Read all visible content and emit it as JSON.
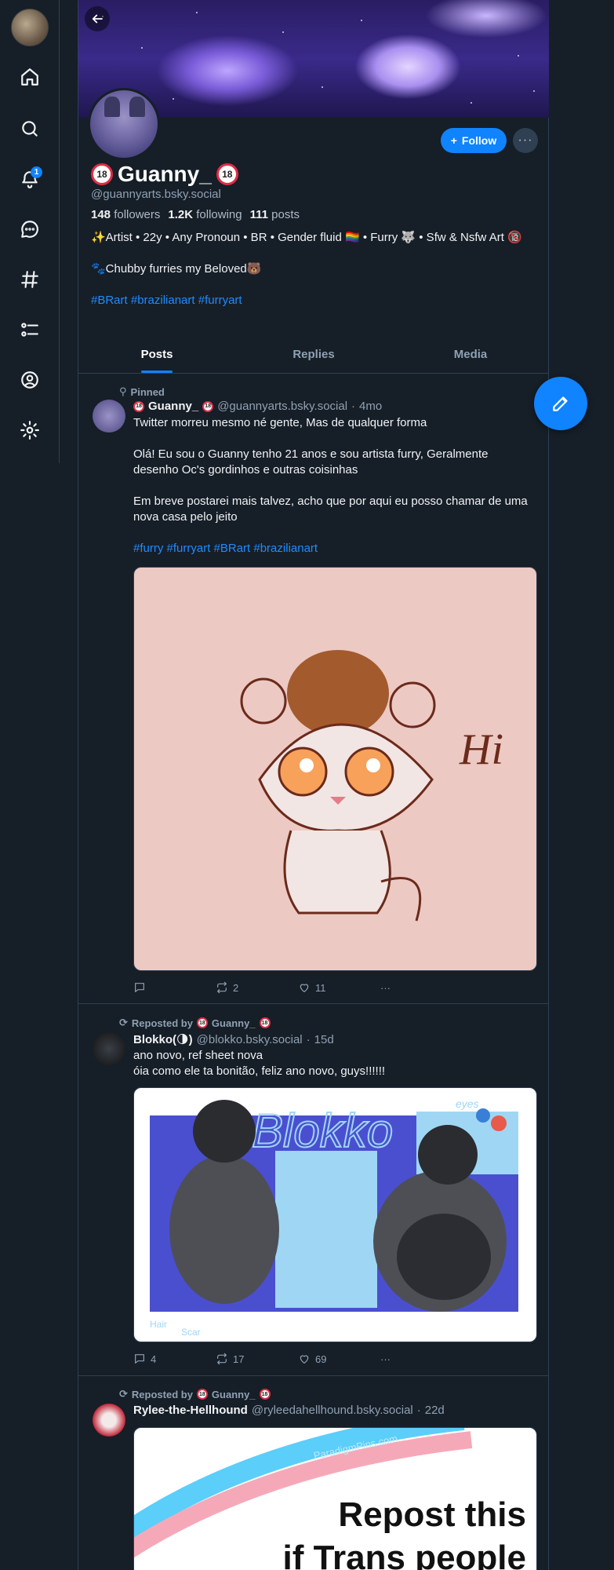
{
  "nav": {
    "items": [
      "home",
      "search",
      "notifications",
      "chat",
      "feeds",
      "lists",
      "profile",
      "settings"
    ],
    "notification_count": "1"
  },
  "profile": {
    "display_name": "Guanny_",
    "age_badge": "18",
    "handle": "@guannyarts.bsky.social",
    "followers_count": "148",
    "followers_label": "followers",
    "following_count": "1.2K",
    "following_label": "following",
    "posts_count": "111",
    "posts_label": "posts",
    "bio_line1": "✨Artist • 22y • Any Pronoun • BR • Gender fluid 🏳️‍🌈 • Furry 🐺 •  Sfw & Nsfw Art 🔞",
    "bio_line2": "🐾Chubby furries my Beloved🐻",
    "bio_tags": "#BRart #brazilianart #furryart",
    "follow_label": "Follow",
    "more_label": "···"
  },
  "tabs": [
    "Posts",
    "Replies",
    "Media"
  ],
  "accent_color": "#1083fe",
  "posts": [
    {
      "context": "Pinned",
      "author": "Guanny_",
      "handle": "@guannyarts.bsky.social",
      "age": "4mo",
      "paragraph1": "Twitter morreu mesmo né gente, Mas de qualquer forma",
      "paragraph2": "Olá! Eu sou o Guanny tenho 21 anos e sou artista furry, Geralmente desenho Oc's gordinhos e outras coisinhas",
      "paragraph3": "Em breve postarei mais talvez, acho que por aqui eu posso chamar de uma nova casa pelo jeito",
      "tags": "#furry #furryart #BRart #brazilianart",
      "image_text": "Hi",
      "replies": "",
      "reposts": "2",
      "likes": "11"
    },
    {
      "context": "Reposted by",
      "context_name": "Guanny_",
      "author": "Blokko(🌗)",
      "handle": "@blokko.bsky.social",
      "age": "15d",
      "line1": "ano novo, ref sheet nova",
      "line2": "óia como ele ta bonitão, feliz ano novo, guys!!!!!!",
      "image_text": "Blokko",
      "image_labels": [
        "eyes",
        "Hair",
        "Scar"
      ],
      "replies": "4",
      "reposts": "17",
      "likes": "69"
    },
    {
      "context": "Reposted by",
      "context_name": "Guanny_",
      "author": "Rylee-the-Hellhound",
      "handle": "@ryleedahellhound.bsky.social",
      "age": "22d",
      "image_watermark": "ParadigmPins.com",
      "image_line1": "Repost this",
      "image_line2": "if Trans people"
    }
  ]
}
